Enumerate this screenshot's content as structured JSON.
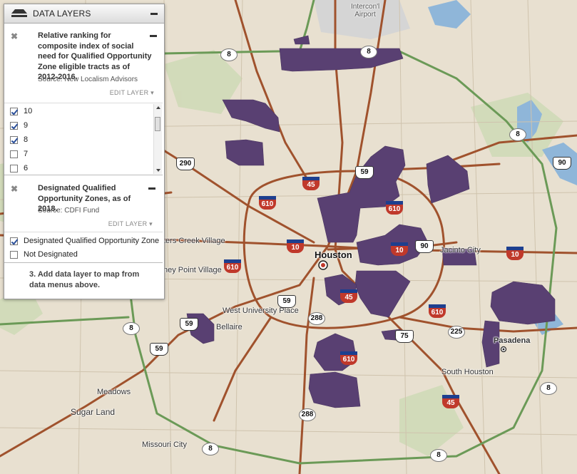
{
  "panel": {
    "title": "DATA LAYERS",
    "layer1": {
      "description": "Relative ranking for composite index of social need for Qualified Opportunity Zone eligible tracts as of 2012-2016.",
      "source": "Source: New Localism Advisors",
      "edit_label": "EDIT LAYER",
      "items": [
        {
          "label": "10",
          "checked": true
        },
        {
          "label": "9",
          "checked": true
        },
        {
          "label": "8",
          "checked": true
        },
        {
          "label": "7",
          "checked": false
        },
        {
          "label": "6",
          "checked": false
        }
      ]
    },
    "layer2": {
      "description": "Designated Qualified Opportunity Zones, as of 2018.",
      "source": "Source: CDFI Fund",
      "edit_label": "EDIT LAYER",
      "items": [
        {
          "label": "Designated Qualified Opportunity Zone",
          "checked": true
        },
        {
          "label": "Not Designated",
          "checked": false
        }
      ]
    },
    "add_layer_text": "3. Add data layer to map from data menus above."
  },
  "map": {
    "labels": {
      "houston": "Houston",
      "jacinto_city": "Jacinto City",
      "pasadena": "Pasadena",
      "south_houston": "South Houston",
      "bellaire": "Bellaire",
      "west_university": "West University Place",
      "meadows": "Meadows",
      "sugar_land": "Sugar Land",
      "missouri_city": "Missouri City",
      "hunters_creek": "ters Creek Village",
      "piney_point": "ney Point Village",
      "airport": "Intercon'l Airport"
    },
    "shields": {
      "s8a": "8",
      "s8b": "8",
      "s8c": "8",
      "s8d": "8",
      "s8e": "8",
      "s8f": "8",
      "s8g": "8",
      "i610a": "610",
      "i610b": "610",
      "i610c": "610",
      "i610d": "610",
      "i610e": "610",
      "i45a": "45",
      "i45b": "45",
      "i45c": "45",
      "i10a": "10",
      "i10b": "10",
      "i10c": "10",
      "u59a": "59",
      "u59b": "59",
      "u59c": "59",
      "u59d": "59",
      "u290": "290",
      "u90a": "90",
      "u90b": "90",
      "s288a": "288",
      "s288b": "288",
      "s225": "225",
      "u75": "75"
    },
    "colors": {
      "zone": "#594072",
      "highway": "#a0522d",
      "beltway": "#6b9a57",
      "land": "#e8e0d0",
      "water": "#8fb6d9"
    }
  }
}
